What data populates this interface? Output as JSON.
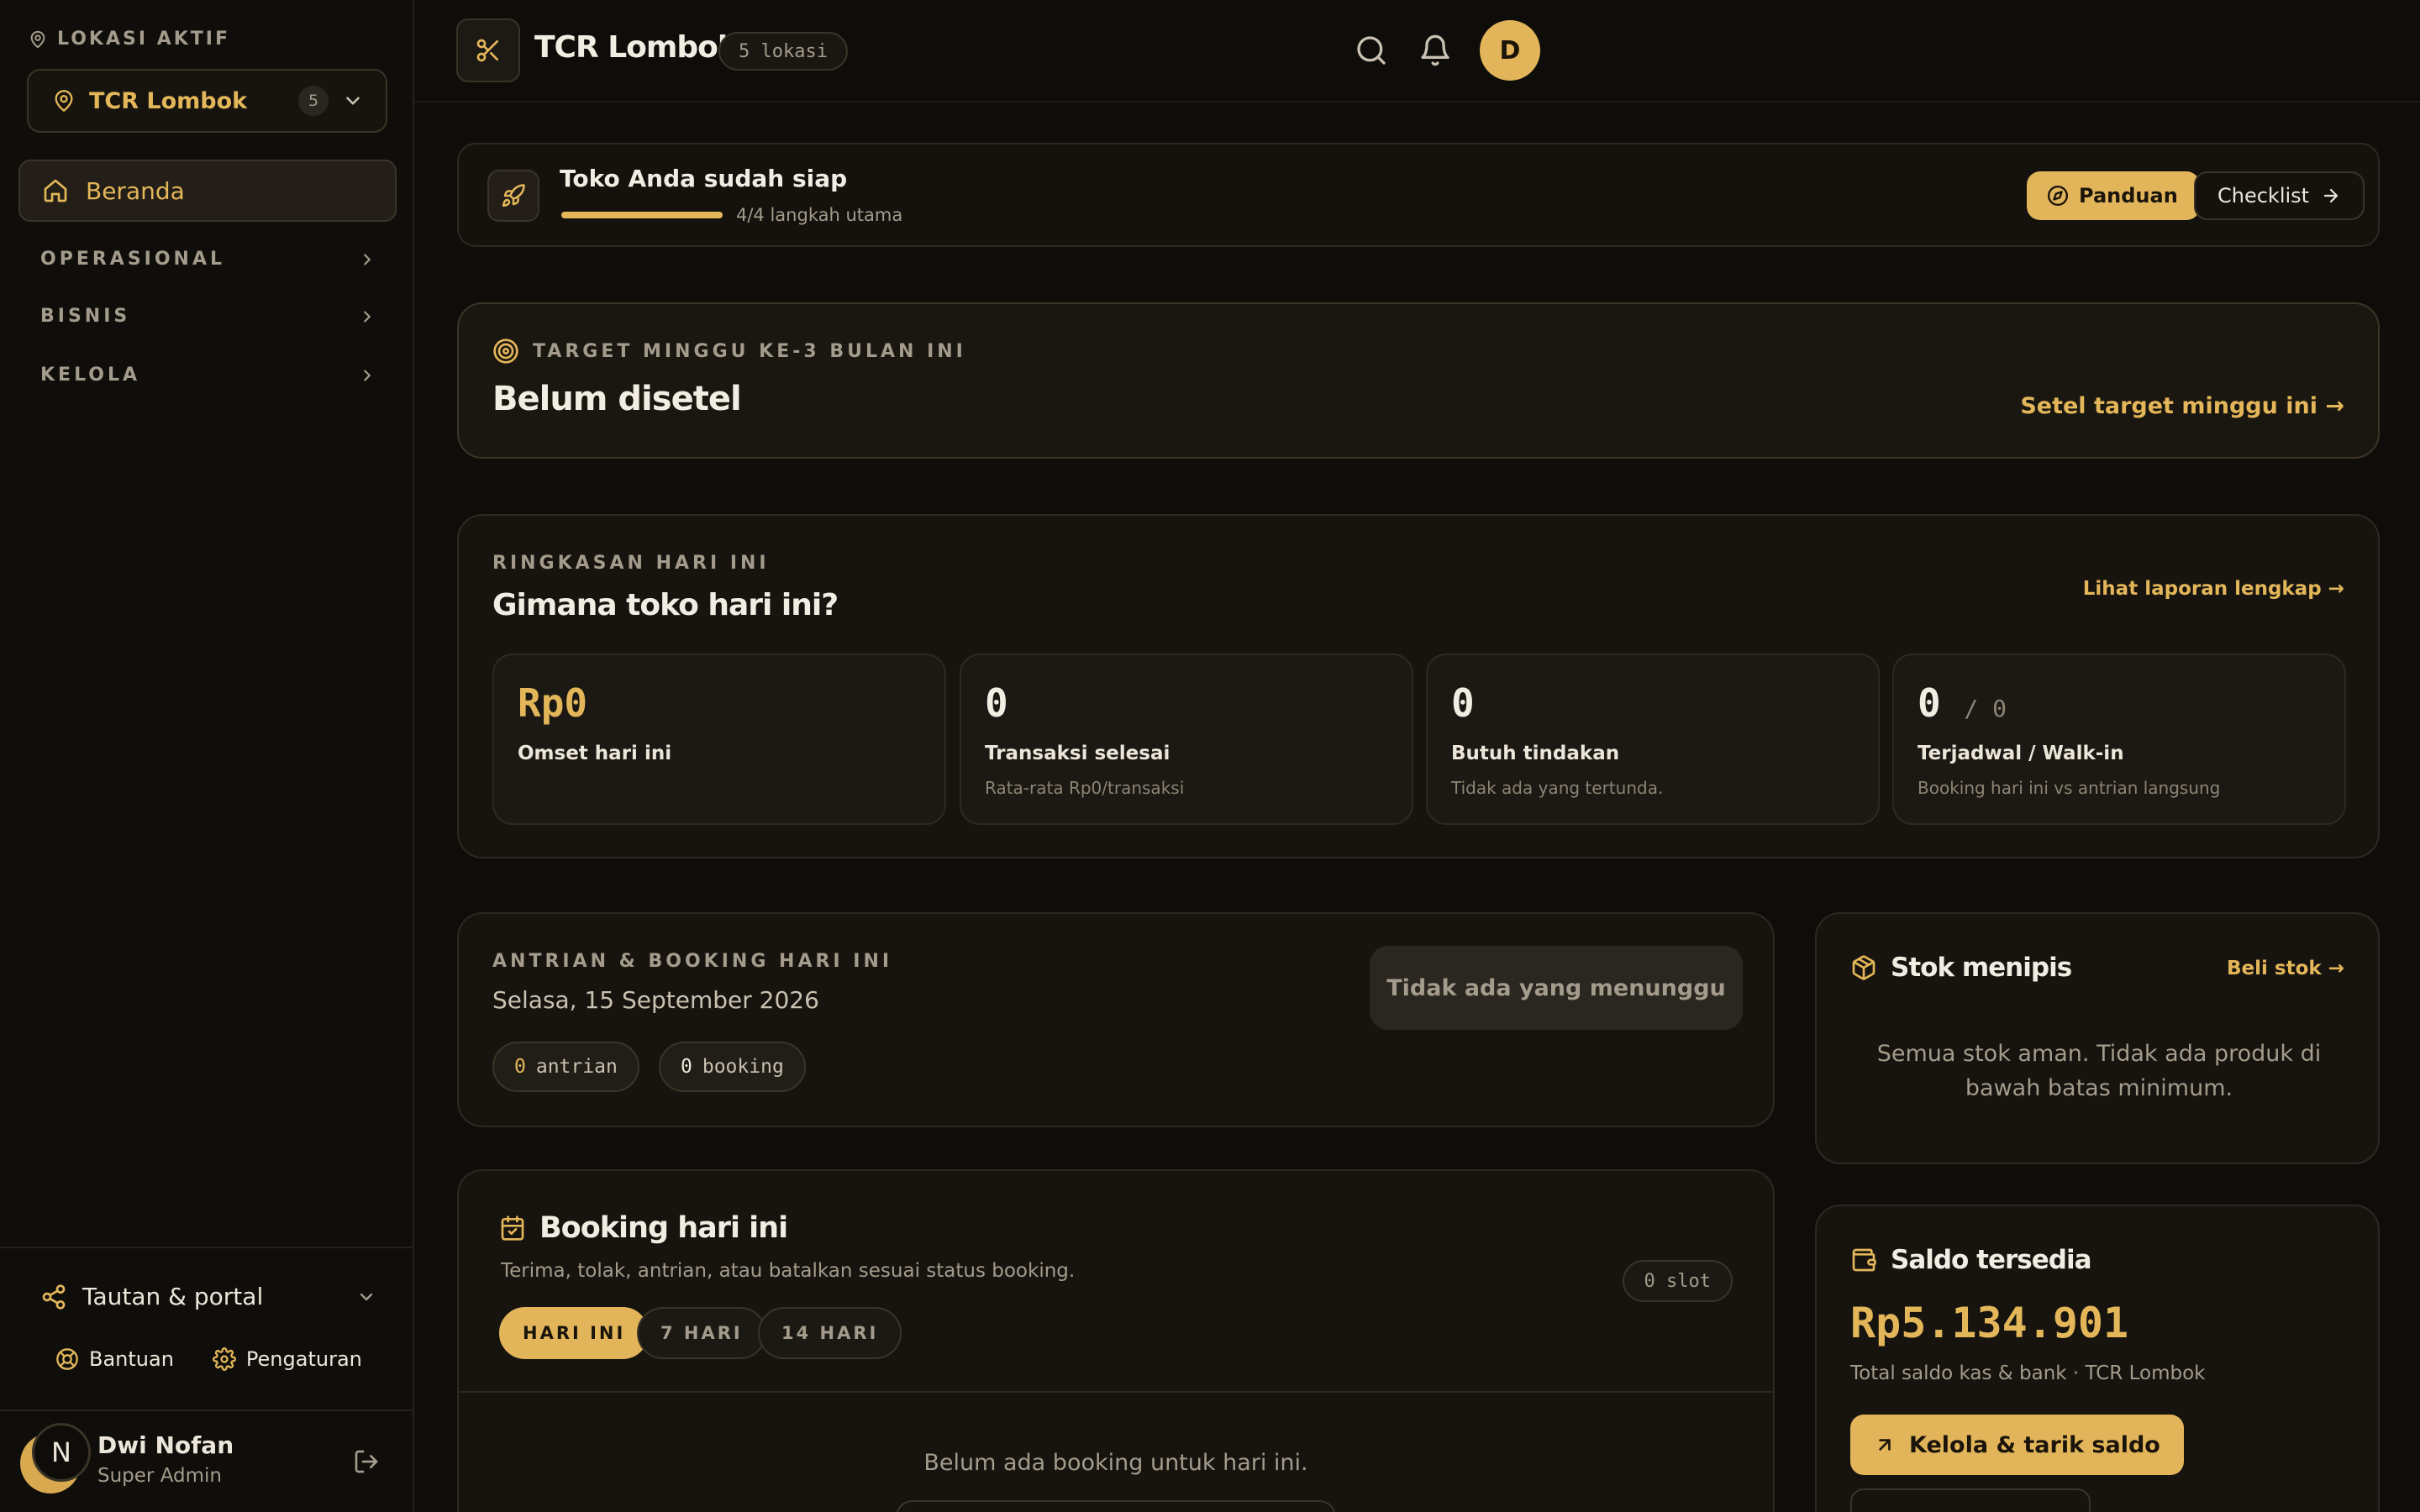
{
  "colors": {
    "accent": "#e3b659",
    "background": "#0f0d0a",
    "card": "#17140f",
    "muted": "#a39b8b"
  },
  "sidebar": {
    "location_label": "LOKASI AKTIF",
    "location_name": "TCR Lombok",
    "location_count": "5",
    "home_label": "Beranda",
    "groups": [
      {
        "label": "OPERASIONAL"
      },
      {
        "label": "BISNIS"
      },
      {
        "label": "KELOLA"
      }
    ],
    "portal_label": "Tautan & portal",
    "help_label": "Bantuan",
    "settings_label": "Pengaturan",
    "user": {
      "initial": "N",
      "name": "Dwi Nofan",
      "role": "Super Admin"
    }
  },
  "header": {
    "title": "TCR Lombok",
    "badge": "5 lokasi",
    "avatar_initial": "D",
    "icons": [
      "scissors-icon",
      "search-icon",
      "bell-icon"
    ]
  },
  "ready": {
    "title": "Toko Anda sudah siap",
    "steps": "4/4 langkah utama",
    "progress": 1.0,
    "panduan_label": "Panduan",
    "checklist_label": "Checklist"
  },
  "target": {
    "label": "TARGET MINGGU KE-3 BULAN INI",
    "value": "Belum disetel",
    "cta": "Setel target minggu ini →"
  },
  "summary": {
    "label": "RINGKASAN HARI INI",
    "heading": "Gimana toko hari ini?",
    "cta": "Lihat laporan lengkap →",
    "stats": [
      {
        "value": "Rp0",
        "title": "Omset hari ini",
        "desc": ""
      },
      {
        "value": "0",
        "title": "Transaksi selesai",
        "desc": "Rata-rata Rp0/transaksi"
      },
      {
        "value": "0",
        "title": "Butuh tindakan",
        "desc": "Tidak ada yang tertunda."
      },
      {
        "value": "0",
        "value_sub": "/ 0",
        "title": "Terjadwal / Walk-in",
        "desc": "Booking hari ini vs antrian langsung"
      }
    ]
  },
  "queue": {
    "label": "ANTRIAN & BOOKING HARI INI",
    "date": "Selasa, 15 September 2026",
    "queue_count": "0",
    "queue_word": "antrian",
    "booking_count": "0",
    "booking_word": "booking",
    "status_button": "Tidak ada yang menunggu"
  },
  "stock": {
    "title": "Stok menipis",
    "cta": "Beli stok →",
    "message": "Semua stok aman. Tidak ada produk di bawah batas minimum."
  },
  "booking": {
    "title": "Booking hari ini",
    "desc": "Terima, tolak, antrian, atau batalkan sesuai status booking.",
    "slot": "0 slot",
    "tabs": [
      {
        "label": "HARI INI",
        "active": true
      },
      {
        "label": "7 HARI",
        "active": false
      },
      {
        "label": "14 HARI",
        "active": false
      }
    ],
    "empty": "Belum ada booking untuk hari ini."
  },
  "saldo": {
    "title": "Saldo tersedia",
    "amount": "Rp5.134.901",
    "sub": "Total saldo kas & bank · TCR Lombok",
    "button": "Kelola & tarik saldo"
  }
}
